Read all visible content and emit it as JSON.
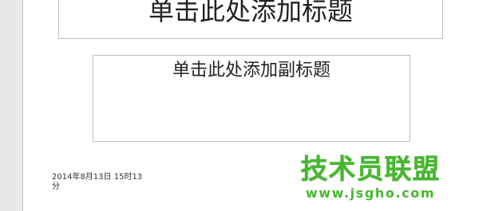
{
  "slide": {
    "title_placeholder": "单击此处添加标题",
    "subtitle_placeholder": "单击此处添加副标题",
    "footer_date": "2014年8月13日 15时13分"
  },
  "watermark": {
    "brand": "技术员联盟",
    "url": "www.jsgho.com"
  },
  "colors": {
    "watermark_green": "#46b82e",
    "placeholder_border": "#bdbdbd",
    "app_background": "#e9e9e9"
  }
}
